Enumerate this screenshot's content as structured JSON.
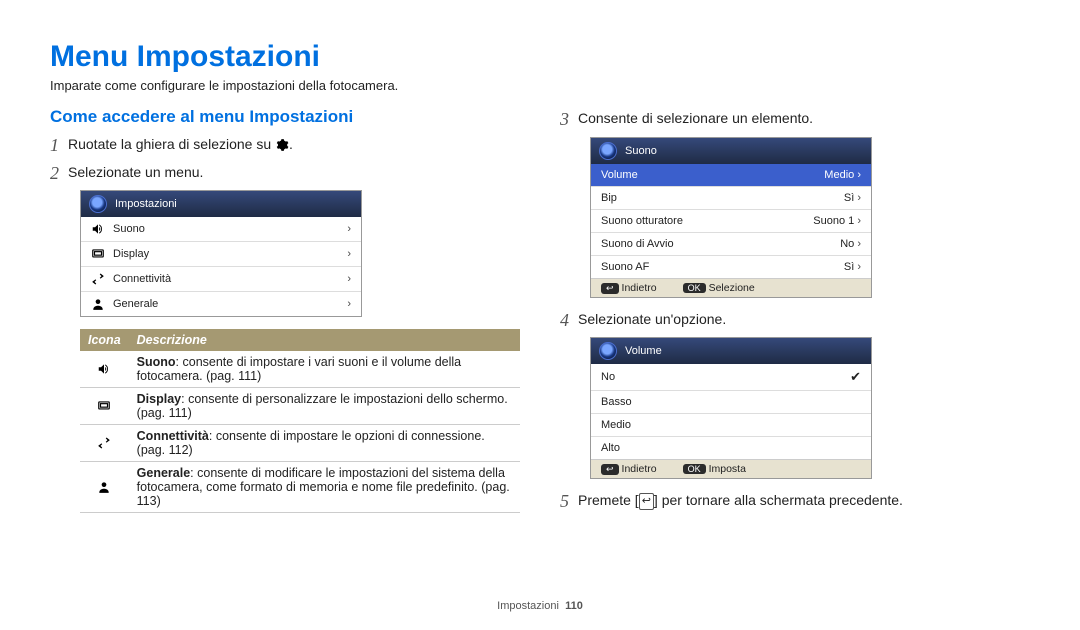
{
  "title": "Menu Impostazioni",
  "intro": "Imparate come configurare le impostazioni della fotocamera.",
  "section_heading": "Come accedere al menu Impostazioni",
  "steps": {
    "s1": {
      "num": "1",
      "text_before": "Ruotate la ghiera di selezione su ",
      "text_after": "."
    },
    "s2": {
      "num": "2",
      "text": "Selezionate un menu."
    },
    "s3": {
      "num": "3",
      "text": "Consente di selezionare un elemento."
    },
    "s4": {
      "num": "4",
      "text": "Selezionate un'opzione."
    },
    "s5": {
      "num": "5",
      "text_before": "Premete [",
      "text_after": "] per tornare alla schermata precedente."
    }
  },
  "screenshot1": {
    "header": "Impostazioni",
    "items": [
      {
        "label": "Suono",
        "icon": "speaker"
      },
      {
        "label": "Display",
        "icon": "display"
      },
      {
        "label": "Connettività",
        "icon": "swap"
      },
      {
        "label": "Generale",
        "icon": "person"
      }
    ]
  },
  "screenshot2": {
    "header": "Suono",
    "items": [
      {
        "label": "Volume",
        "value": "Medio"
      },
      {
        "label": "Bip",
        "value": "Sì"
      },
      {
        "label": "Suono otturatore",
        "value": "Suono 1"
      },
      {
        "label": "Suono di Avvio",
        "value": "No"
      },
      {
        "label": "Suono AF",
        "value": "Sì"
      }
    ],
    "footer_back": "Indietro",
    "footer_ok_label": "OK",
    "footer_ok": "Selezione"
  },
  "screenshot3": {
    "header": "Volume",
    "items": [
      {
        "label": "No",
        "selected": true
      },
      {
        "label": "Basso"
      },
      {
        "label": "Medio"
      },
      {
        "label": "Alto"
      }
    ],
    "footer_back": "Indietro",
    "footer_ok_label": "OK",
    "footer_ok": "Imposta"
  },
  "desc_table": {
    "header_icon": "Icona",
    "header_desc": "Descrizione",
    "rows": [
      {
        "icon": "speaker",
        "bold": "Suono",
        "rest": ": consente di impostare i vari suoni e il volume della fotocamera. (pag. 111)"
      },
      {
        "icon": "display",
        "bold": "Display",
        "rest": ": consente di personalizzare le impostazioni dello schermo. (pag. 111)"
      },
      {
        "icon": "swap",
        "bold": "Connettività",
        "rest": ": consente di impostare le opzioni di connessione. (pag. 112)"
      },
      {
        "icon": "person",
        "bold": "Generale",
        "rest": ": consente di modificare le impostazioni del sistema della fotocamera, come formato di memoria e nome file predefinito. (pag. 113)"
      }
    ]
  },
  "footer": {
    "section": "Impostazioni",
    "page": "110"
  },
  "icons": {
    "back_sym": "↩"
  }
}
